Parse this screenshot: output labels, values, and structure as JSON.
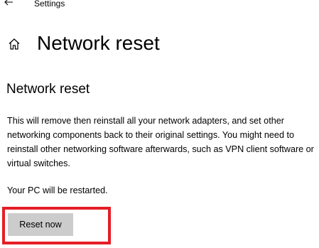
{
  "window": {
    "app_title": "Settings",
    "back_icon": "back-arrow-icon"
  },
  "header": {
    "home_icon": "home-icon",
    "page_title": "Network reset"
  },
  "main": {
    "section_title": "Network reset",
    "description": "This will remove then reinstall all your network adapters, and set other networking components back to their original settings. You might need to reinstall other networking software afterwards, such as VPN client software or virtual switches.",
    "restart_note": "Your PC will be restarted.",
    "reset_button_label": "Reset now"
  },
  "colors": {
    "highlight_border": "#e41e26",
    "button_background": "#cccccc"
  }
}
